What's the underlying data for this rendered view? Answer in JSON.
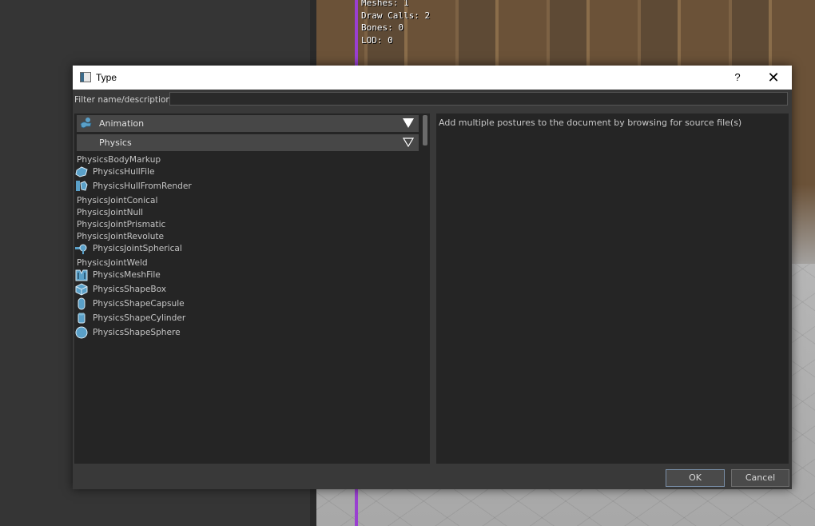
{
  "viewport_stats": [
    "Meshes: 1",
    "Draw Calls: 2",
    "Bones: 0",
    "LOD: 0"
  ],
  "dialog": {
    "title": "Type",
    "help_glyph": "?",
    "close_glyph": "✕",
    "filter_label": "Filter name/description:",
    "filter_value": "",
    "categories": [
      {
        "label": "Animation",
        "icon": "animation-icon",
        "expanded": false
      },
      {
        "label": "Physics",
        "icon": "",
        "expanded": true
      }
    ],
    "items": [
      {
        "label": "PhysicsBodyMarkup",
        "icon": ""
      },
      {
        "label": "PhysicsHullFile",
        "icon": "hull-file-icon"
      },
      {
        "label": "PhysicsHullFromRender",
        "icon": "hull-from-render-icon"
      },
      {
        "label": "PhysicsJointConical",
        "icon": ""
      },
      {
        "label": "PhysicsJointNull",
        "icon": ""
      },
      {
        "label": "PhysicsJointPrismatic",
        "icon": ""
      },
      {
        "label": "PhysicsJointRevolute",
        "icon": ""
      },
      {
        "label": "PhysicsJointSpherical",
        "icon": "joint-spherical-icon"
      },
      {
        "label": "PhysicsJointWeld",
        "icon": ""
      },
      {
        "label": "PhysicsMeshFile",
        "icon": "mesh-file-icon"
      },
      {
        "label": "PhysicsShapeBox",
        "icon": "shape-box-icon"
      },
      {
        "label": "PhysicsShapeCapsule",
        "icon": "shape-capsule-icon"
      },
      {
        "label": "PhysicsShapeCylinder",
        "icon": "shape-cylinder-icon"
      },
      {
        "label": "PhysicsShapeSphere",
        "icon": "shape-sphere-icon"
      }
    ],
    "description": "Add multiple postures to the document by browsing for source file(s)",
    "ok_label": "OK",
    "cancel_label": "Cancel",
    "accent_color": "#5aa0c8"
  }
}
